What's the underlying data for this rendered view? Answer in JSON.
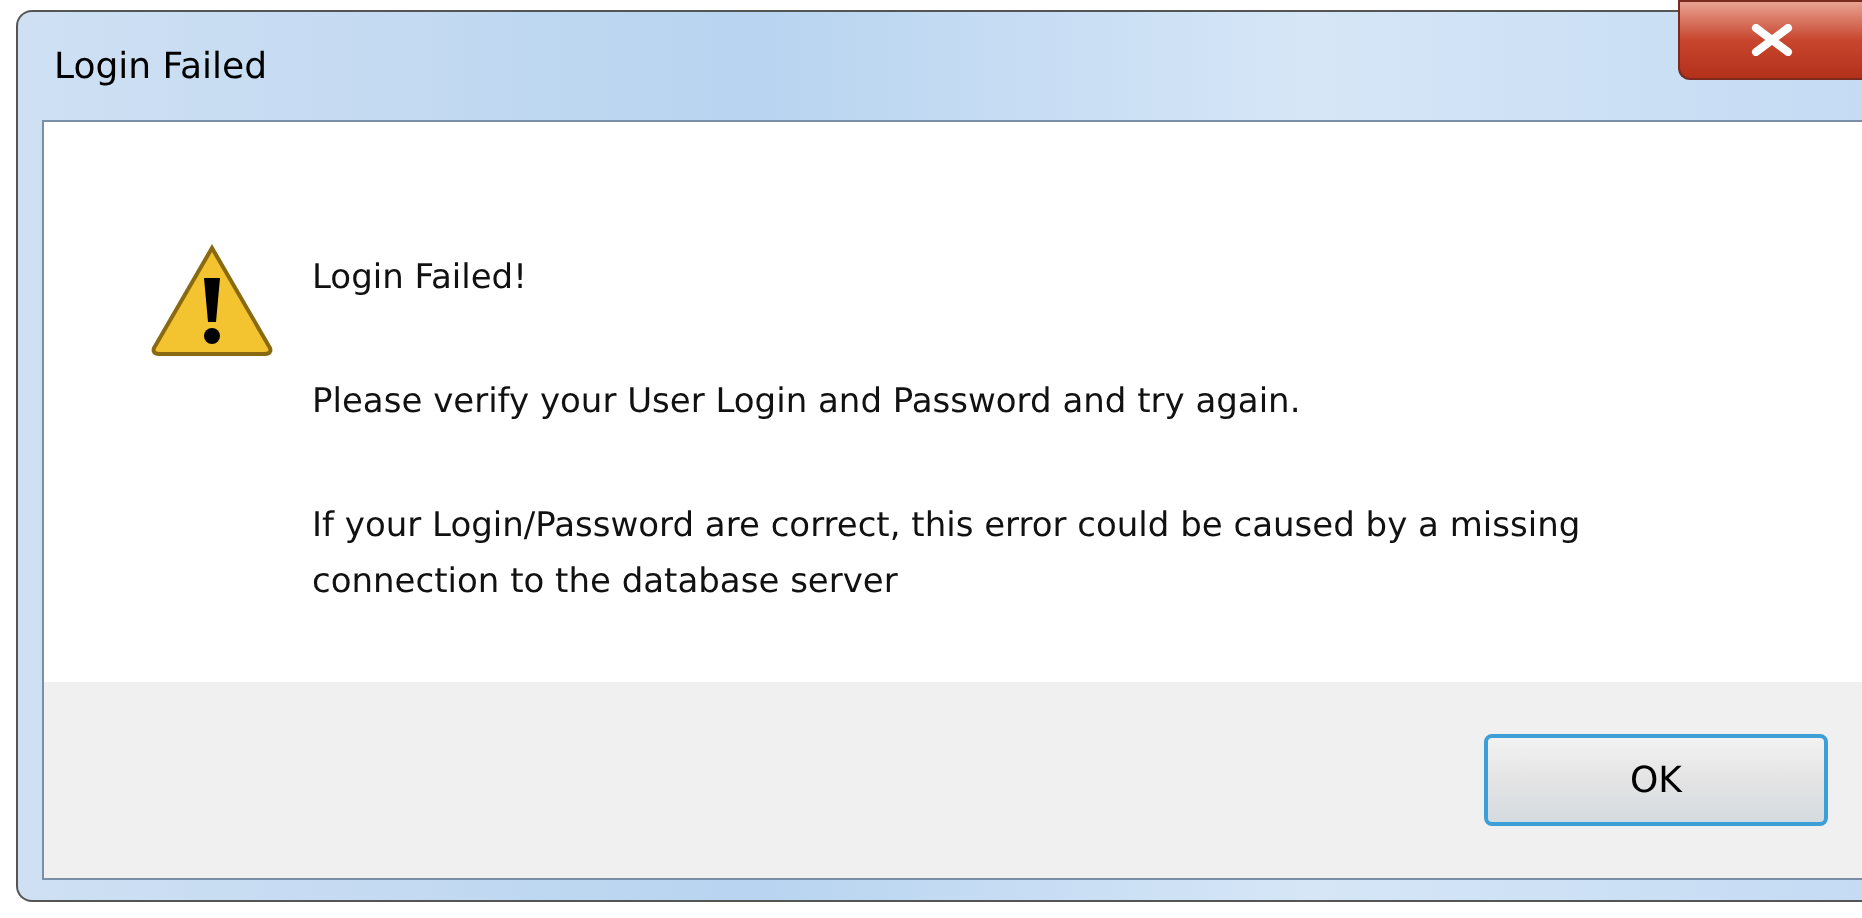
{
  "window": {
    "title": "Login Failed"
  },
  "message": {
    "heading": "Login Failed!",
    "paragraphs": [
      "Please verify your User Login and Password and try again.",
      "If your Login/Password are correct, this error could be caused by a missing connection to the database server"
    ]
  },
  "buttons": [
    {
      "label": "OK",
      "focused": true
    }
  ]
}
